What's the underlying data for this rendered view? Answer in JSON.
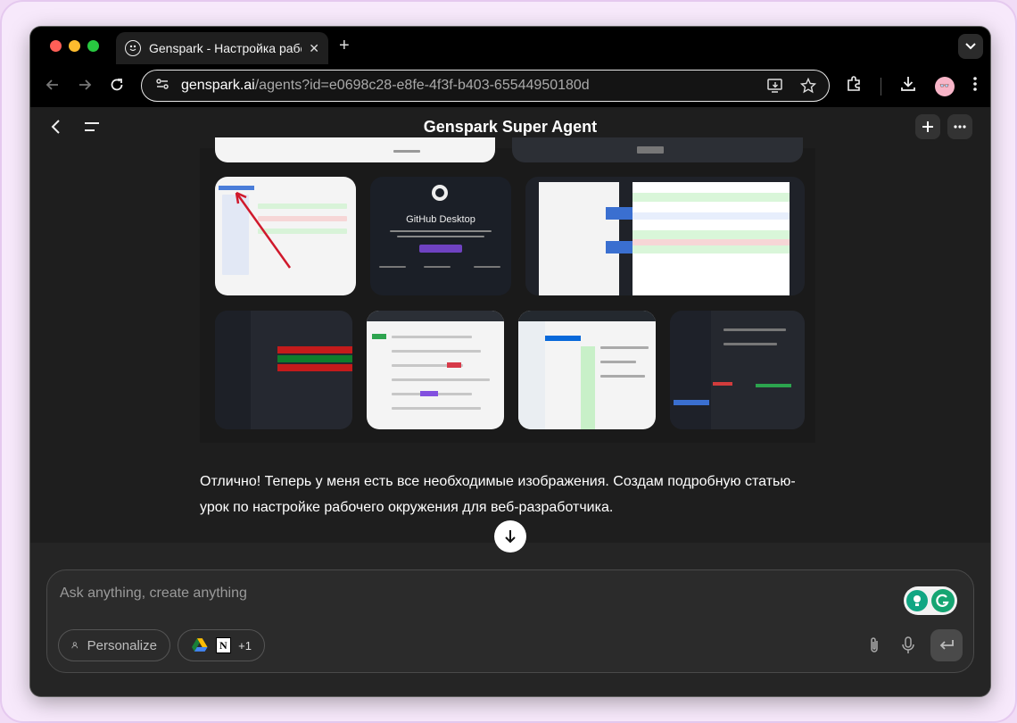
{
  "browser": {
    "tab_title": "Genspark - Настройка рабоч",
    "url_host": "genspark.ai",
    "url_path": "/agents?id=e0698c28-e8fe-4f3f-b403-65544950180d",
    "avatar_text": "👓"
  },
  "app": {
    "title": "Genspark Super Agent"
  },
  "gallery": {
    "thumbnails": [
      {
        "name": "sublime-diff",
        "caption": ""
      },
      {
        "name": "github-desktop",
        "caption": "GitHub Desktop"
      },
      {
        "name": "code-diff-dark",
        "caption": ""
      },
      {
        "name": "dark-editor-1",
        "caption": ""
      },
      {
        "name": "light-pr-list",
        "caption": ""
      },
      {
        "name": "split-diff",
        "caption": ""
      },
      {
        "name": "dark-editor-2",
        "caption": ""
      }
    ]
  },
  "message": {
    "text": "Отлично! Теперь у меня есть все необходимые изображения. Создам подробную статью-урок по настройке рабочего окружения для веб-разработчика."
  },
  "composer": {
    "placeholder": "Ask anything, create anything",
    "personalize_label": "Personalize",
    "integrations_more": "+1"
  }
}
